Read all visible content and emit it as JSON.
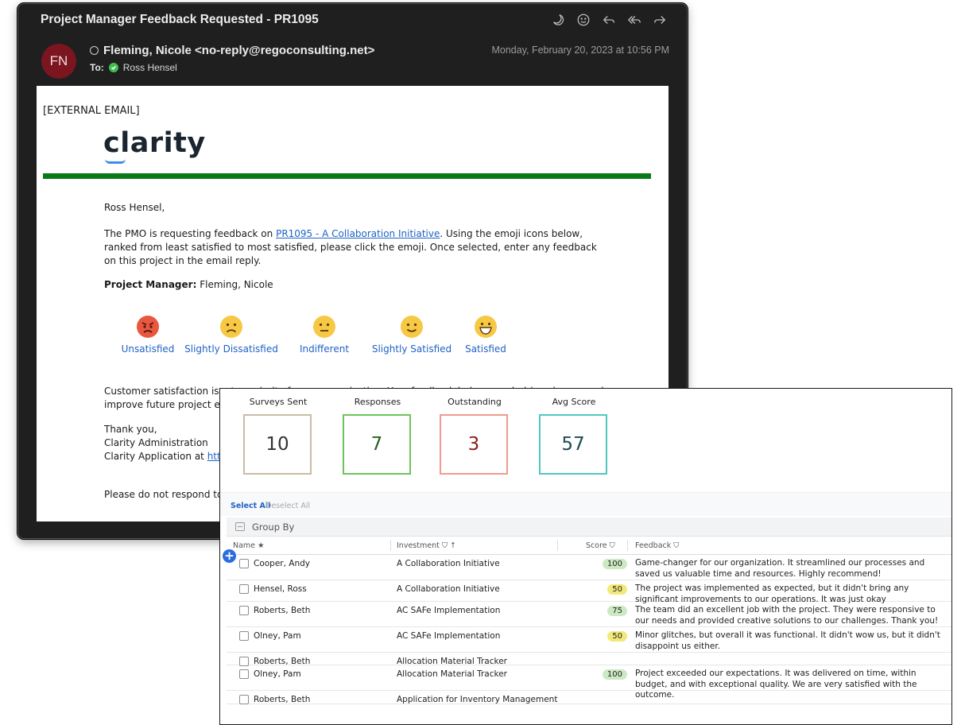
{
  "email": {
    "window_title": "Project Manager Feedback Requested - PR1095",
    "avatar_initials": "FN",
    "sender": "Fleming, Nicole <no-reply@regoconsulting.net>",
    "to_label": "To:",
    "recipient": "Ross Hensel",
    "date": "Monday, February 20, 2023 at 10:56 PM",
    "toolbar_icons": [
      "moon-icon",
      "smiley-icon",
      "reply-icon",
      "reply-all-icon",
      "forward-icon"
    ],
    "body": {
      "external_label": "[EXTERNAL EMAIL]",
      "logo_text": "clarity",
      "accent_green": "#0a7a17",
      "greeting": "Ross Hensel,",
      "para1_before": "The PMO is requesting feedback on ",
      "para1_link": "PR1095 - A Collaboration Initiative",
      "para1_after": ". Using the emoji icons below, ranked from least satisfied to most satisfied, please click the emoji. Once selected, enter any feedback on this project in the email reply.",
      "pm_label": "Project Manager:",
      "pm_value": "Fleming, Nicole",
      "emojis": [
        {
          "label": "Unsatisfied",
          "icon": "angry-face-icon"
        },
        {
          "label": "Slightly Dissatisfied",
          "icon": "frowning-face-icon"
        },
        {
          "label": "Indifferent",
          "icon": "neutral-face-icon"
        },
        {
          "label": "Slightly Satisfied",
          "icon": "slightly-smiling-face-icon"
        },
        {
          "label": "Satisfied",
          "icon": "grinning-face-icon"
        }
      ],
      "para2": "Customer satisfaction is a top priority for our organization. Your feedback help reward, drive change and improve future project exe",
      "thanks": "Thank you,",
      "sig1": "Clarity Administration",
      "sig2_prefix": "Clarity Application at ",
      "sig2_link": "https",
      "no_respond": "Please do not respond to t"
    }
  },
  "dashboard": {
    "kpis": [
      {
        "label": "Surveys Sent",
        "value": "10",
        "border": "#c9bca6"
      },
      {
        "label": "Responses",
        "value": "7",
        "border": "#6cc45a"
      },
      {
        "label": "Outstanding",
        "value": "3",
        "border": "#ef9a8e"
      },
      {
        "label": "Avg Score",
        "value": "57",
        "border": "#50c8be"
      }
    ],
    "select_all": "Select All",
    "deselect_all": "Deselect All",
    "group_by": "Group By",
    "columns": {
      "name": "Name ★",
      "investment": "Investment ⛉ ↑",
      "score": "Score ⛉",
      "feedback": "Feedback ⛉"
    },
    "rows": [
      {
        "name": "Cooper, Andy",
        "investment": "A Collaboration Initiative",
        "score": "100",
        "score_color": "#cde9c3",
        "feedback": "Game-changer for our organization. It streamlined our processes and saved us valuable time and resources. Highly recommend!"
      },
      {
        "name": "Hensel, Ross",
        "investment": "A Collaboration Initiative",
        "score": "50",
        "score_color": "#f3e97a",
        "feedback": "The project was implemented as expected, but it didn't bring any significant improvements to our operations. It was just okay"
      },
      {
        "name": "Roberts, Beth",
        "investment": "AC SAFe Implementation",
        "score": "75",
        "score_color": "#cde9c3",
        "feedback": "The team did an excellent job with the project. They were responsive to our needs and provided creative solutions to our challenges. Thank you!"
      },
      {
        "name": "Olney, Pam",
        "investment": "AC SAFe Implementation",
        "score": "50",
        "score_color": "#f3e97a",
        "feedback": "Minor glitches, but overall it was functional. It didn't wow us, but it didn't disappoint us either."
      },
      {
        "name": "Roberts, Beth",
        "investment": "Allocation Material Tracker",
        "score": "",
        "score_color": "",
        "feedback": ""
      },
      {
        "name": "Olney, Pam",
        "investment": "Allocation Material Tracker",
        "score": "100",
        "score_color": "#cde9c3",
        "feedback": "Project exceeded our expectations. It was delivered on time, within budget, and with exceptional quality. We are very satisfied with the outcome."
      },
      {
        "name": "Roberts, Beth",
        "investment": "Application for Inventory Management",
        "score": "",
        "score_color": "",
        "feedback": ""
      }
    ]
  }
}
